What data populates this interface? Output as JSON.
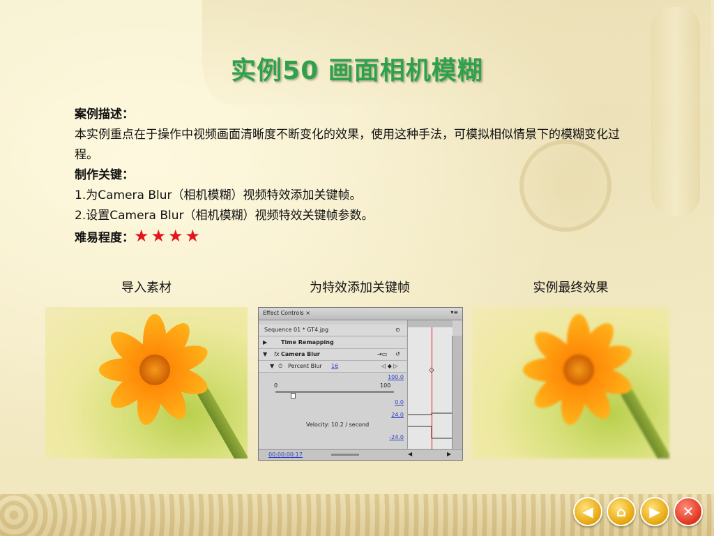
{
  "slide": {
    "title": "实例50   画面相机模糊",
    "description_heading": "案例描述：",
    "description_text": "本实例重点在于操作中视频画面清晰度不断变化的效果，使用这种手法，可模拟相似情景下的模糊变化过程。",
    "key_heading": "制作关键：",
    "key_steps": [
      "1.为Camera Blur（相机模糊）视频特效添加关键帧。",
      "2.设置Camera Blur（相机模糊）视频特效关键帧参数。"
    ],
    "difficulty_label": "难易程度：",
    "difficulty_stars": "★★★★"
  },
  "captions": {
    "import": "导入素材",
    "keyframe": "为特效添加关键帧",
    "result": "实例最终效果"
  },
  "effect_panel": {
    "tab_label": "Effect Controls ×",
    "sequence": "Sequence 01 * GT4.jpg",
    "time_remapping": "Time Remapping",
    "fx_label": "fx",
    "effect_name": "Camera Blur",
    "param_name": "Percent Blur",
    "param_value": "16",
    "max_value": "100.0",
    "slider_min": "0",
    "slider_max": "100",
    "value_low": "0.0",
    "velocity_top": "24.0",
    "velocity_text": "Velocity: 10.2 / second",
    "velocity_bottom": "-24.0",
    "timecode": "00:00:00:17"
  },
  "nav": {
    "back_icon": "◀",
    "home_icon": "⌂",
    "forward_icon": "▶",
    "close_icon": "✕"
  },
  "colors": {
    "title": "#2fa14a",
    "stars": "#e3151c"
  }
}
